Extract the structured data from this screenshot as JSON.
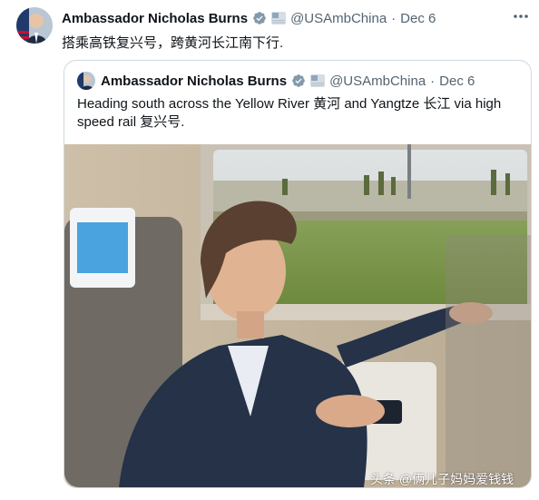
{
  "tweet": {
    "author_name": "Ambassador Nicholas Burns",
    "handle": "@USAmbChina",
    "separator": "·",
    "date": "Dec 6",
    "text": "搭乘高铁复兴号，跨黄河长江南下行.",
    "more_icon": "more-horizontal-icon",
    "colors": {
      "name": "#0f1419",
      "secondary": "#536471",
      "verified": "#829aab",
      "border": "#cfd9de"
    }
  },
  "quote": {
    "author_name": "Ambassador Nicholas Burns",
    "handle": "@USAmbChina",
    "separator": "·",
    "date": "Dec 6",
    "text": "Heading south across the Yellow River 黄河 and Yangtze 长江 via high speed rail 复兴号."
  },
  "photo": {
    "subject": "photo-man-on-train"
  },
  "watermark": {
    "text": "头条 @俩儿子妈妈爱钱钱"
  }
}
